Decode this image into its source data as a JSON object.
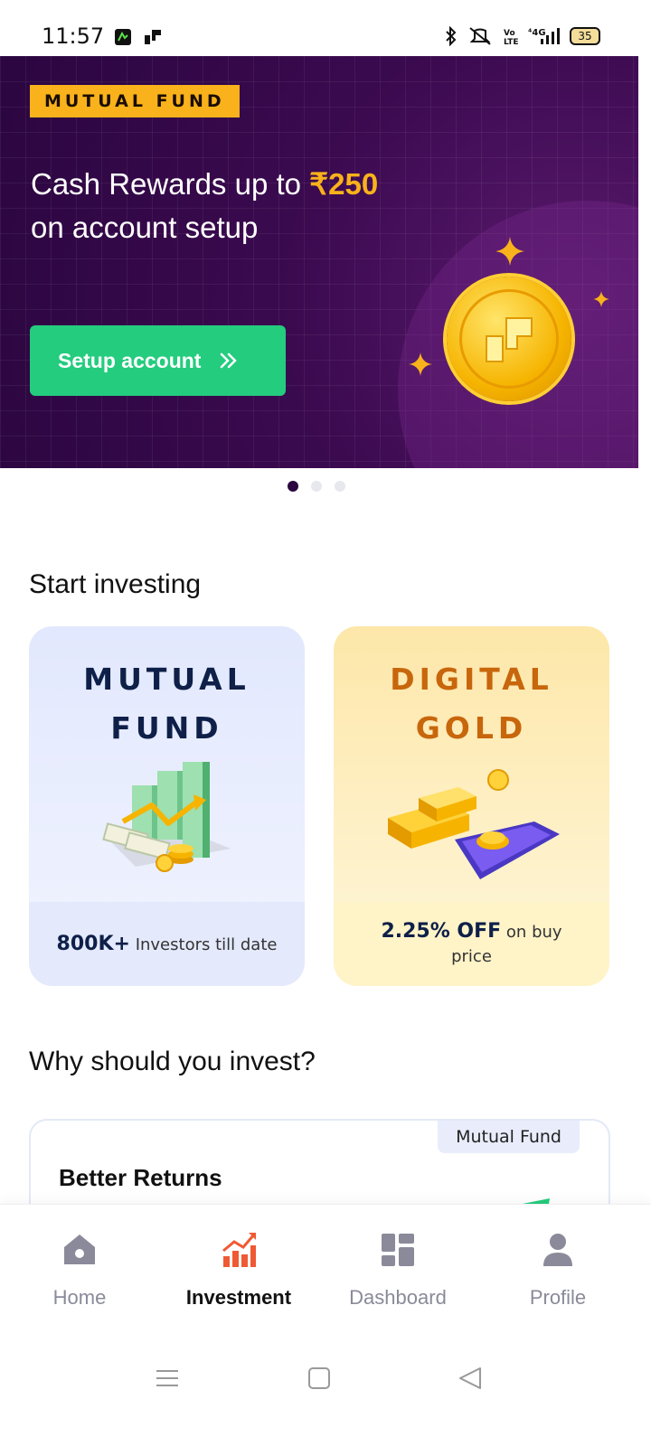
{
  "status_bar": {
    "time": "11:57",
    "battery": "35",
    "left_icons": [
      "app-notification-icon",
      "app-logo-icon"
    ],
    "right_icons": [
      "bluetooth-icon",
      "mute-icon",
      "volte-icon",
      "4g-signal-icon",
      "battery-icon"
    ]
  },
  "hero": {
    "tag": "MUTUAL FUND",
    "title_prefix": "Cash Rewards up to",
    "title_amount": "₹250",
    "title_suffix": "on account setup",
    "button_label": "Setup account",
    "button_icon": "double-chevron-right-icon",
    "colors": {
      "background": "#3b0a4f",
      "tag": "#f9b21b",
      "button": "#24cc7e"
    }
  },
  "carousel": {
    "count": 3,
    "active_index": 0
  },
  "start_investing": {
    "title": "Start investing",
    "cards": [
      {
        "title_line1": "MUTUAL",
        "title_line2": "FUND",
        "stat": "800K+",
        "stat_text": "Investors till date",
        "icon": "mutual-fund-chart-icon"
      },
      {
        "title_line1": "DIGITAL",
        "title_line2": "GOLD",
        "stat": "2.25% OFF",
        "stat_text": "on buy price",
        "icon": "gold-bars-phone-icon"
      }
    ]
  },
  "why_invest": {
    "title": "Why should you invest?",
    "card": {
      "badge": "Mutual Fund",
      "title": "Better Returns"
    }
  },
  "bottom_nav": {
    "items": [
      {
        "label": "Home",
        "icon": "home-icon",
        "active": false
      },
      {
        "label": "Investment",
        "icon": "investment-chart-icon",
        "active": true
      },
      {
        "label": "Dashboard",
        "icon": "dashboard-icon",
        "active": false
      },
      {
        "label": "Profile",
        "icon": "profile-icon",
        "active": false
      }
    ]
  },
  "system_nav": [
    "menu-icon",
    "home-square-icon",
    "back-icon"
  ]
}
